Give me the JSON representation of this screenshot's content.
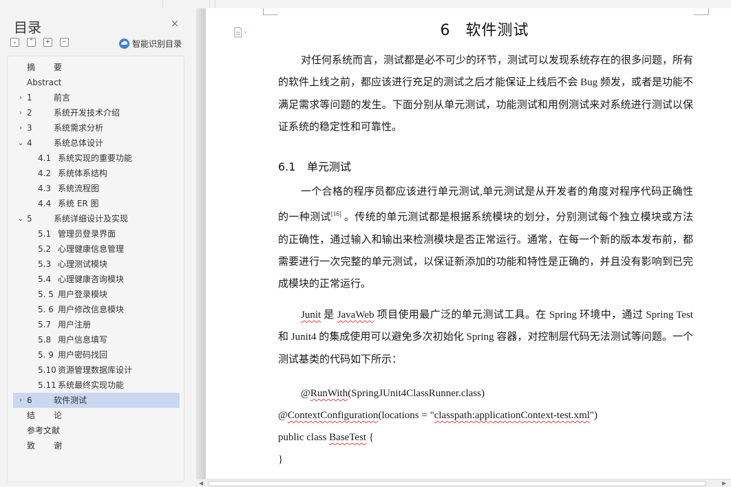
{
  "sidebar": {
    "title": "目录",
    "close_icon": "×",
    "tools": [
      "⌄",
      "⌃",
      "+",
      "−"
    ],
    "smart_toc_label": "智能识别目录",
    "items": [
      {
        "num": "摘",
        "text": "要",
        "level": 0,
        "chevron": ""
      },
      {
        "num": "",
        "text": "Abstract",
        "level": 0,
        "chevron": ""
      },
      {
        "num": "1",
        "text": "前言",
        "level": 0,
        "chevron": "›"
      },
      {
        "num": "2",
        "text": "系统开发技术介绍",
        "level": 0,
        "chevron": "›"
      },
      {
        "num": "3",
        "text": "系统需求分析",
        "level": 0,
        "chevron": "›"
      },
      {
        "num": "4",
        "text": "系统总体设计",
        "level": 0,
        "chevron": "⌄"
      },
      {
        "num": "4.1",
        "text": "系统实现的重要功能",
        "level": 1,
        "chevron": ""
      },
      {
        "num": "4.2",
        "text": "系统体系结构",
        "level": 1,
        "chevron": ""
      },
      {
        "num": "4.3",
        "text": "系统流程图",
        "level": 1,
        "chevron": ""
      },
      {
        "num": "4.4",
        "text": "系统 ER 图",
        "level": 1,
        "chevron": ""
      },
      {
        "num": "5",
        "text": "系统详细设计及实现",
        "level": 0,
        "chevron": "⌄"
      },
      {
        "num": "5.1",
        "text": "管理员登录界面",
        "level": 1,
        "chevron": ""
      },
      {
        "num": "5.2",
        "text": "心理健康信息管理",
        "level": 1,
        "chevron": ""
      },
      {
        "num": "5.3",
        "text": "心理测试模块",
        "level": 1,
        "chevron": ""
      },
      {
        "num": "5.4",
        "text": "心理健康咨询模块",
        "level": 1,
        "chevron": ""
      },
      {
        "num": "5. 5",
        "text": "用户登录模块",
        "level": 1,
        "chevron": ""
      },
      {
        "num": "5. 6",
        "text": "用户修改信息模块",
        "level": 1,
        "chevron": ""
      },
      {
        "num": "5.7",
        "text": "用户注册",
        "level": 1,
        "chevron": ""
      },
      {
        "num": "5.8",
        "text": "用户信息填写",
        "level": 1,
        "chevron": ""
      },
      {
        "num": "5. 9",
        "text": "用户密码找回",
        "level": 1,
        "chevron": ""
      },
      {
        "num": "5.10",
        "text": "资源管理数据库设计",
        "level": 1,
        "chevron": ""
      },
      {
        "num": "5.11",
        "text": "系统最终实现功能",
        "level": 1,
        "chevron": ""
      },
      {
        "num": "6",
        "text": "软件测试",
        "level": 0,
        "chevron": "›",
        "selected": true
      },
      {
        "num": "结",
        "text": "论",
        "level": 0,
        "chevron": ""
      },
      {
        "num": "",
        "text": "参考文献",
        "level": 0,
        "chevron": ""
      },
      {
        "num": "致",
        "text": "谢",
        "level": 0,
        "chevron": ""
      }
    ]
  },
  "document": {
    "chapter_num": "6",
    "chapter_title": "软件测试",
    "intro": "对任何系统而言，测试都是必不可少的环节，测试可以发现系统存在的很多问题，所有的软件上线之前，都应该进行充足的测试之后才能保证上线后不会 Bug 频发，或者是功能不满足需求等问题的发生。下面分别从单元测试，功能测试和用例测试来对系统进行测试以保证系统的稳定性和可靠性。",
    "section_num": "6.1",
    "section_title": "单元测试",
    "p1_a": "一个合格的程序员都应该进行单元测试,单元测试是从开发者的角度对程序代码正确性的一种测试",
    "p1_ref": "[16]",
    "p1_b": " 。传统的单元测试都是根据系统模块的划分，分别测试每个独立模块或方法的正确性，通过输入和输出来检测模块是否正常运行。通常，在每一个新的版本发布前，都需要进行一次完整的单元测试，以保证新添加的功能和特性是正确的，并且没有影响到已完成模块的正常运行。",
    "p2_w1": "Junit",
    "p2_a": " 是 ",
    "p2_w2": "JavaWeb",
    "p2_b": " 项目使用最广泛的单元测试工具。在 Spring 环境中，通过 Spring Test 和 Junit4 的集成使用可以避免多次初始化 Spring 容器，对控制层代码无法测试等问题。一个测试基类的代码如下所示：",
    "code1_at": "@",
    "code1_w": "RunWith",
    "code1_rest": "(SpringJUnit4ClassRunner.class)",
    "code2_at": "@",
    "code2_w": "ContextConfiguration",
    "code2_mid": "(locations = \"",
    "code2_w2": "classpath:applicationContext-test.xml",
    "code2_end": "\")",
    "code3_a": "public class ",
    "code3_w": "BaseTest",
    "code3_b": " {",
    "code4": "}"
  },
  "colors": {
    "selected_bg": "#c9d8f0",
    "accent": "#3f7fe0",
    "spell_underline": "#e04040"
  }
}
